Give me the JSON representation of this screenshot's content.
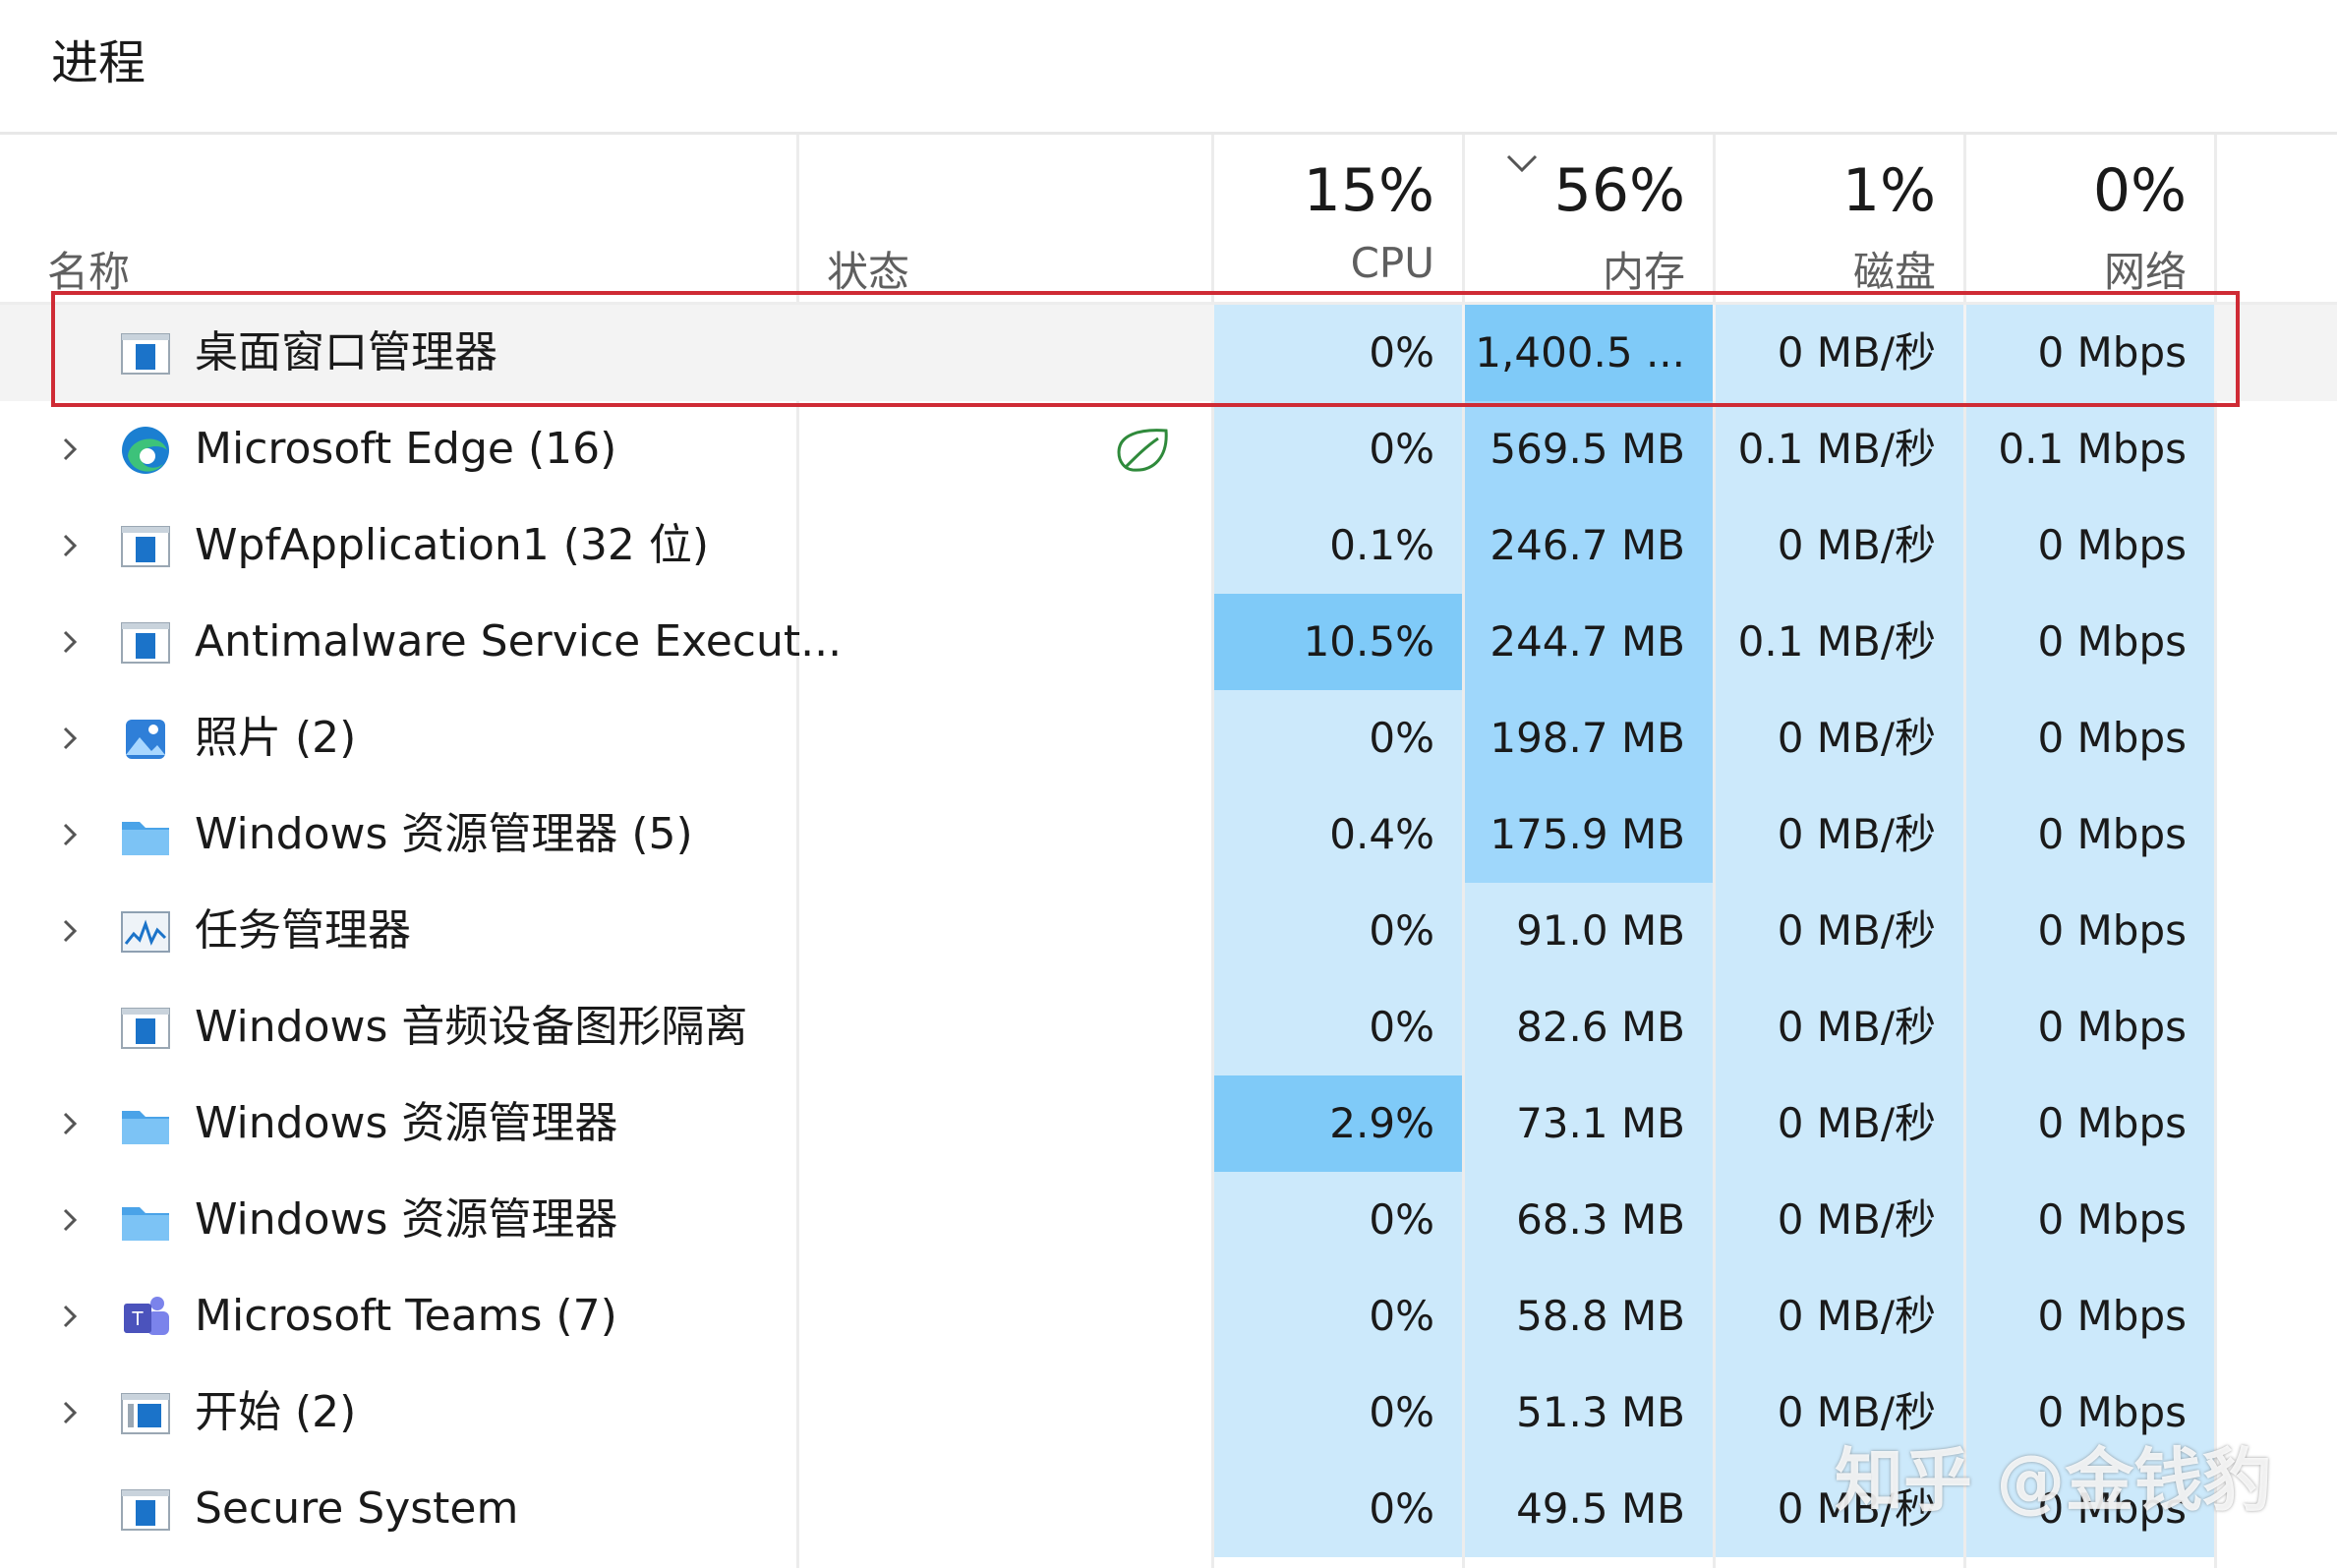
{
  "section_title": "进程",
  "columns": {
    "name": {
      "label": "名称"
    },
    "status": {
      "label": "状态"
    },
    "cpu": {
      "percent": "15%",
      "label": "CPU"
    },
    "memory": {
      "percent": "56%",
      "label": "内存",
      "sorted": "descending"
    },
    "disk": {
      "percent": "1%",
      "label": "磁盘"
    },
    "network": {
      "percent": "0%",
      "label": "网络"
    }
  },
  "colors": {
    "heat_light": "#cce9fb",
    "heat_mid": "#9fd7fb",
    "heat_strong": "#7fcaf8",
    "highlight_border": "#cf2b35",
    "eco_leaf": "#2f8a3b"
  },
  "rows": [
    {
      "name": "桌面窗口管理器",
      "icon": "app-window-icon",
      "expandable": false,
      "status_icon": "",
      "cpu": "0%",
      "memory": "1,400.5 ...",
      "disk": "0 MB/秒",
      "network": "0 Mbps",
      "cpu_heat": "light",
      "mem_heat": "strong",
      "selected": true
    },
    {
      "name": "Microsoft Edge (16)",
      "icon": "edge-icon",
      "expandable": true,
      "status_icon": "efficiency-leaf-icon",
      "cpu": "0%",
      "memory": "569.5 MB",
      "disk": "0.1 MB/秒",
      "network": "0.1 Mbps",
      "cpu_heat": "light",
      "mem_heat": "mid"
    },
    {
      "name": "WpfApplication1 (32 位)",
      "icon": "app-window-icon",
      "expandable": true,
      "status_icon": "",
      "cpu": "0.1%",
      "memory": "246.7 MB",
      "disk": "0 MB/秒",
      "network": "0 Mbps",
      "cpu_heat": "light",
      "mem_heat": "mid"
    },
    {
      "name": "Antimalware Service Execut...",
      "icon": "app-window-icon",
      "expandable": true,
      "status_icon": "",
      "cpu": "10.5%",
      "memory": "244.7 MB",
      "disk": "0.1 MB/秒",
      "network": "0 Mbps",
      "cpu_heat": "strong",
      "mem_heat": "mid"
    },
    {
      "name": "照片 (2)",
      "icon": "photos-icon",
      "expandable": true,
      "status_icon": "",
      "cpu": "0%",
      "memory": "198.7 MB",
      "disk": "0 MB/秒",
      "network": "0 Mbps",
      "cpu_heat": "light",
      "mem_heat": "mid"
    },
    {
      "name": "Windows 资源管理器 (5)",
      "icon": "folder-icon",
      "expandable": true,
      "status_icon": "",
      "cpu": "0.4%",
      "memory": "175.9 MB",
      "disk": "0 MB/秒",
      "network": "0 Mbps",
      "cpu_heat": "light",
      "mem_heat": "mid"
    },
    {
      "name": "任务管理器",
      "icon": "task-manager-icon",
      "expandable": true,
      "status_icon": "",
      "cpu": "0%",
      "memory": "91.0 MB",
      "disk": "0 MB/秒",
      "network": "0 Mbps",
      "cpu_heat": "light",
      "mem_heat": "light"
    },
    {
      "name": "Windows 音频设备图形隔离",
      "icon": "app-window-icon",
      "expandable": false,
      "status_icon": "",
      "cpu": "0%",
      "memory": "82.6 MB",
      "disk": "0 MB/秒",
      "network": "0 Mbps",
      "cpu_heat": "light",
      "mem_heat": "light"
    },
    {
      "name": "Windows 资源管理器",
      "icon": "folder-icon",
      "expandable": true,
      "status_icon": "",
      "cpu": "2.9%",
      "memory": "73.1 MB",
      "disk": "0 MB/秒",
      "network": "0 Mbps",
      "cpu_heat": "strong",
      "mem_heat": "light"
    },
    {
      "name": "Windows 资源管理器",
      "icon": "folder-icon",
      "expandable": true,
      "status_icon": "",
      "cpu": "0%",
      "memory": "68.3 MB",
      "disk": "0 MB/秒",
      "network": "0 Mbps",
      "cpu_heat": "light",
      "mem_heat": "light"
    },
    {
      "name": "Microsoft Teams (7)",
      "icon": "teams-icon",
      "expandable": true,
      "status_icon": "",
      "cpu": "0%",
      "memory": "58.8 MB",
      "disk": "0 MB/秒",
      "network": "0 Mbps",
      "cpu_heat": "light",
      "mem_heat": "light"
    },
    {
      "name": "开始 (2)",
      "icon": "start-app-icon",
      "expandable": true,
      "status_icon": "",
      "cpu": "0%",
      "memory": "51.3 MB",
      "disk": "0 MB/秒",
      "network": "0 Mbps",
      "cpu_heat": "light",
      "mem_heat": "light"
    },
    {
      "name": "Secure System",
      "icon": "app-window-icon",
      "expandable": false,
      "status_icon": "",
      "cpu": "0%",
      "memory": "49.5 MB",
      "disk": "0 MB/秒",
      "network": "0 Mbps",
      "cpu_heat": "light",
      "mem_heat": "light"
    }
  ],
  "watermark": "知乎 @金钱豹"
}
